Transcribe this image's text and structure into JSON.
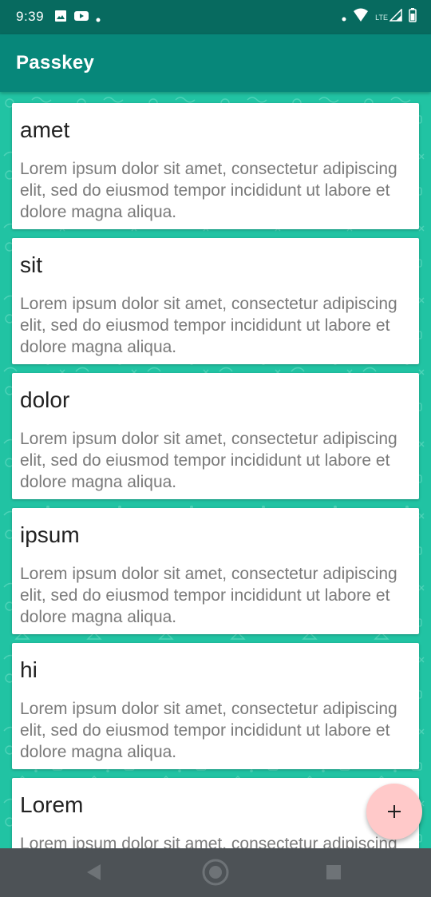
{
  "status_bar": {
    "time": "9:39",
    "network_label": "LTE",
    "icons": [
      "image-icon",
      "youtube-icon",
      "notification-dot-icon",
      "wifi-icon",
      "signal-icon",
      "battery-icon"
    ]
  },
  "app_bar": {
    "title": "Passkey"
  },
  "cards": [
    {
      "title": "amet",
      "body": "Lorem ipsum dolor sit amet, consectetur adipiscing elit, sed do eiusmod tempor incididunt ut labore et dolore magna aliqua."
    },
    {
      "title": "sit",
      "body": "Lorem ipsum dolor sit amet, consectetur adipiscing elit, sed do eiusmod tempor incididunt ut labore et dolore magna aliqua."
    },
    {
      "title": "dolor",
      "body": "Lorem ipsum dolor sit amet, consectetur adipiscing elit, sed do eiusmod tempor incididunt ut labore et dolore magna aliqua."
    },
    {
      "title": "ipsum",
      "body": "Lorem ipsum dolor sit amet, consectetur adipiscing elit, sed do eiusmod tempor incididunt ut labore et dolore magna aliqua."
    },
    {
      "title": "hi",
      "body": "Lorem ipsum dolor sit amet, consectetur adipiscing elit, sed do eiusmod tempor incididunt ut labore et dolore magna aliqua."
    },
    {
      "title": "Lorem",
      "body": "Lorem ipsum dolor sit amet, consectetur adipiscing elit, sed do eiusmod tempor incididunt ut labore et dolore magna aliqua."
    }
  ],
  "fab": {
    "icon": "plus-icon",
    "symbol": "+"
  },
  "navigation": {
    "buttons": [
      "back-icon",
      "home-icon",
      "recents-icon"
    ]
  },
  "colors": {
    "status_bar": "#076a5f",
    "app_bar": "#07877a",
    "background": "#21c3a3",
    "fab": "#ffc9c9",
    "nav_bar": "#4d5256"
  }
}
